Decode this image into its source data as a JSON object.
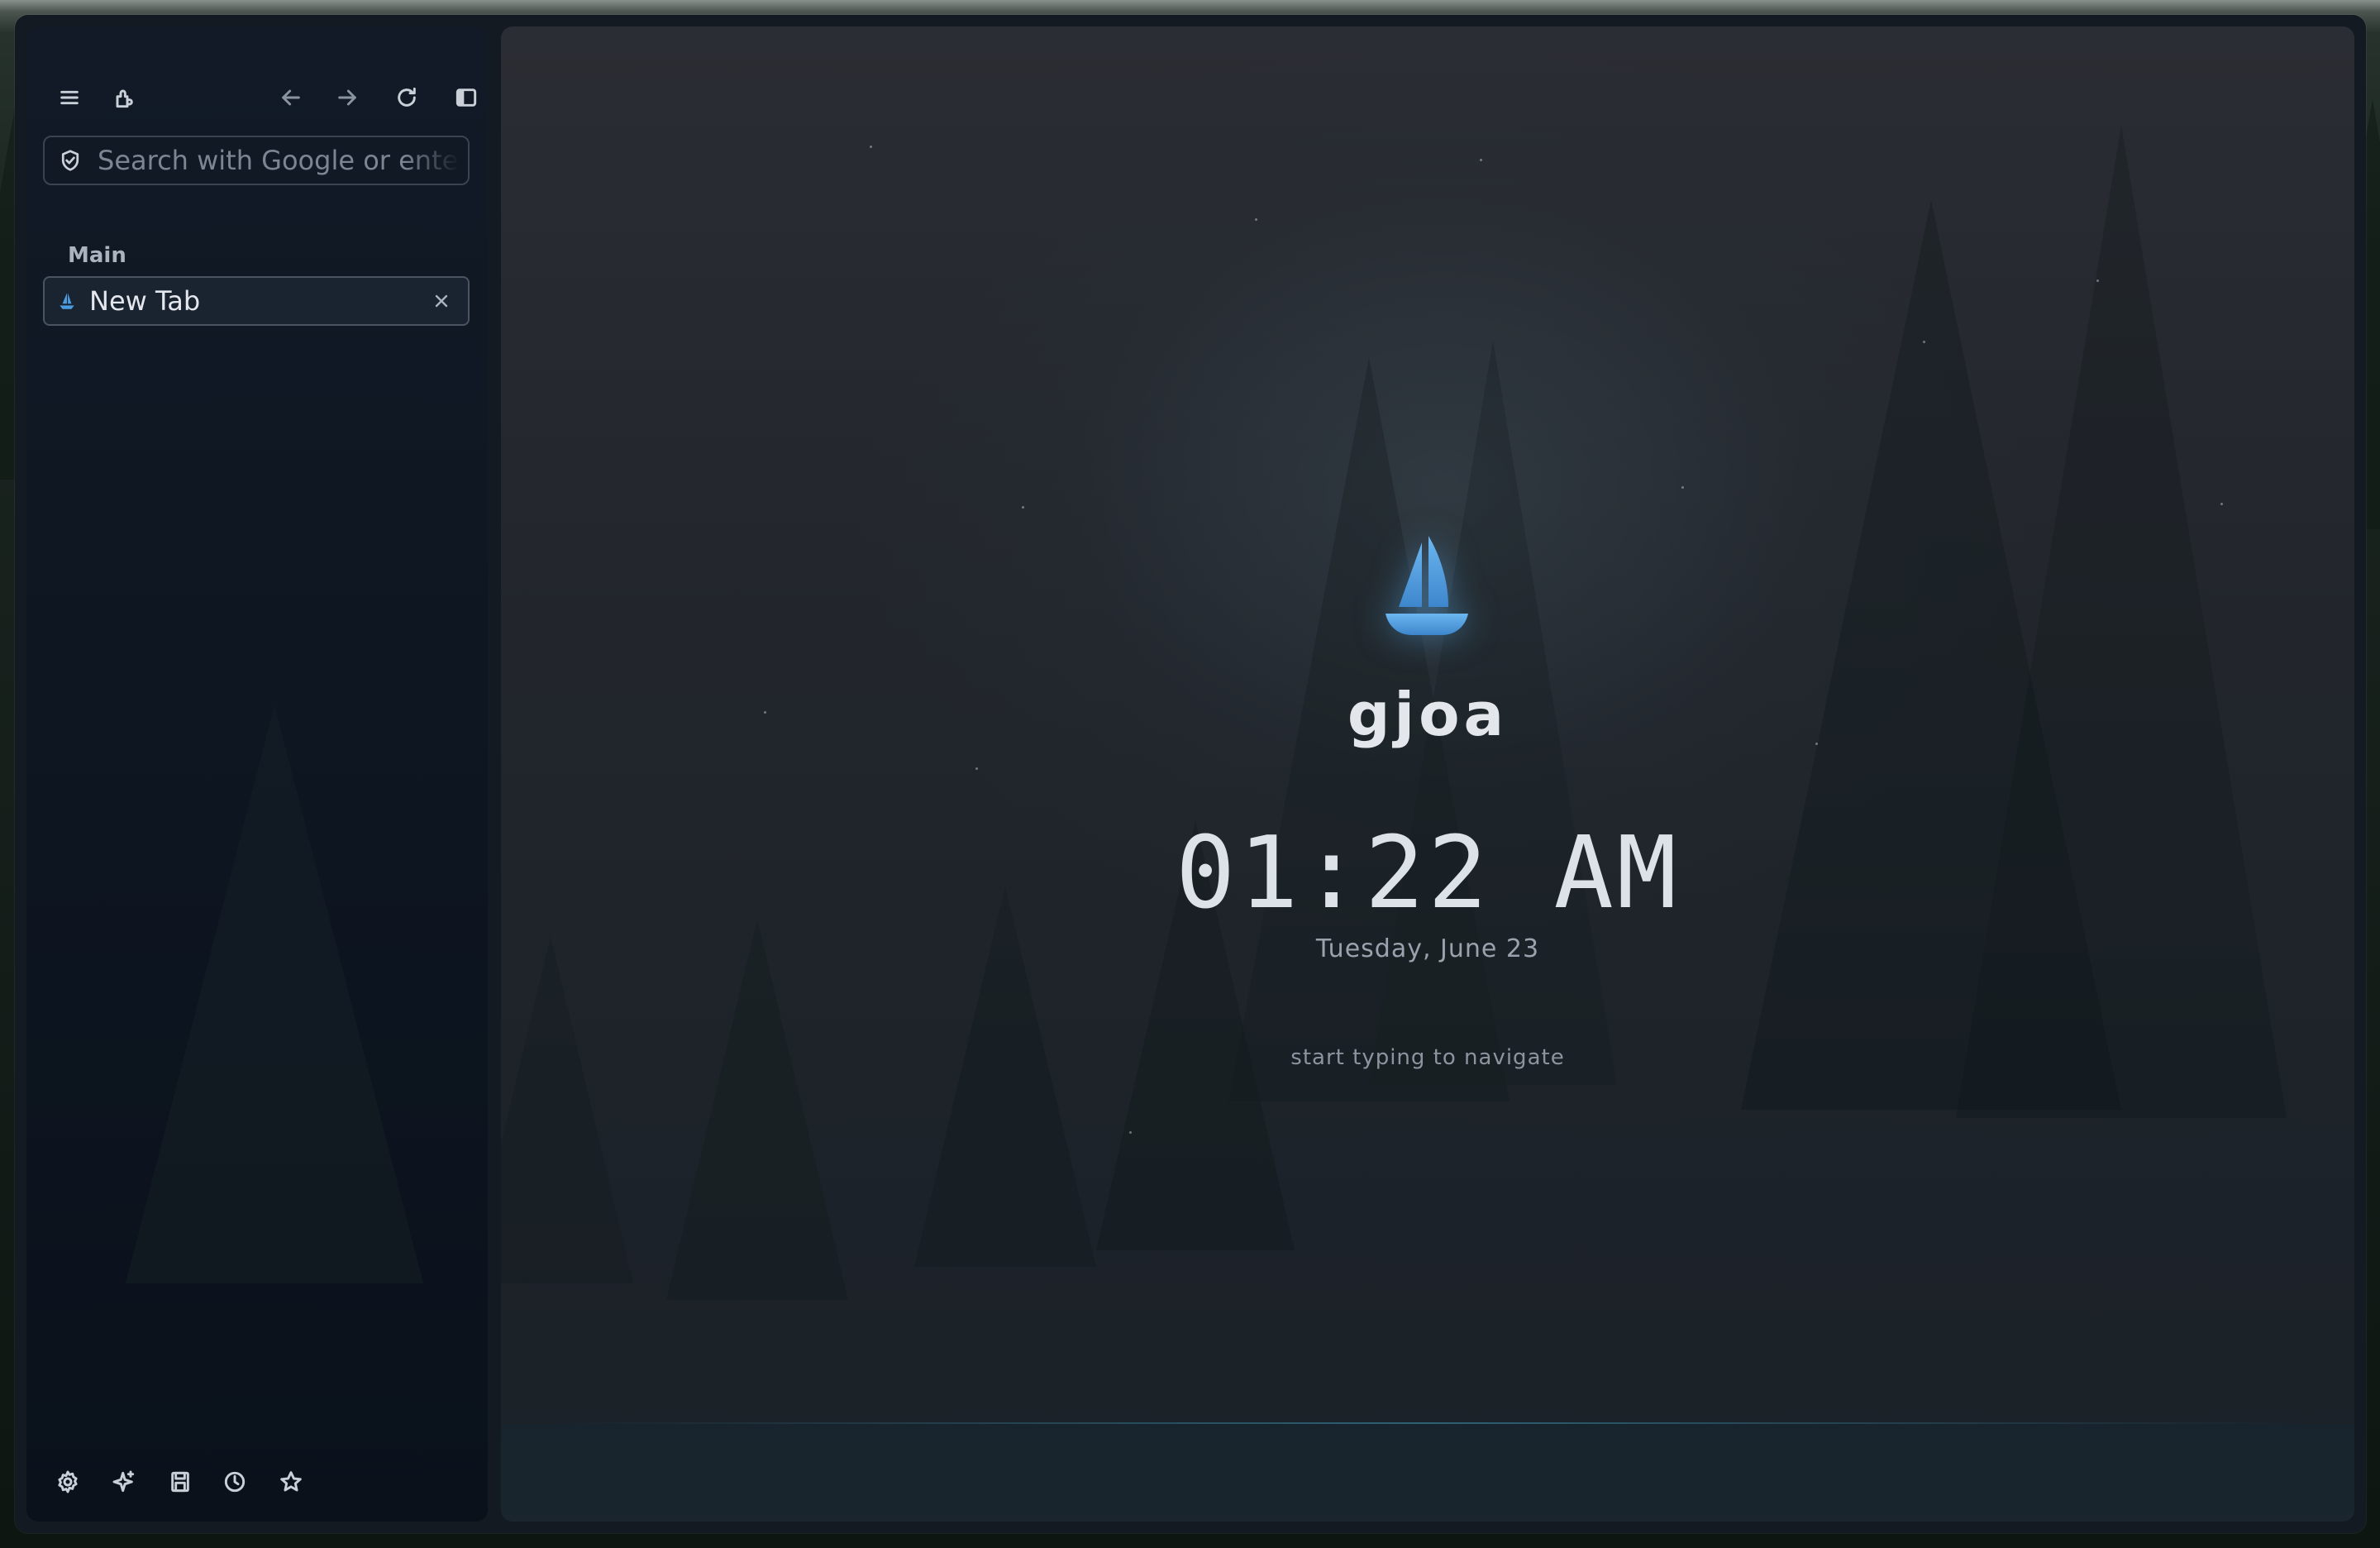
{
  "sidebar": {
    "toolbar": {
      "menu_icon": "menu-icon",
      "extensions_icon": "puzzle-icon",
      "back_icon": "arrow-left-icon",
      "forward_icon": "arrow-right-icon",
      "reload_icon": "reload-icon",
      "sidebar_toggle_icon": "sidebar-toggle-icon"
    },
    "search": {
      "placeholder": "Search with Google or enter address",
      "value": ""
    },
    "section_label": "Main",
    "tabs": [
      {
        "title": "New Tab",
        "favicon": "sailboat-icon",
        "active": true
      }
    ],
    "bottom_tools": [
      "gear-icon",
      "sparkle-icon",
      "save-icon",
      "clock-icon",
      "star-icon"
    ]
  },
  "newtab": {
    "brand": "gjoa",
    "time": "01:22 AM",
    "date": "Tuesday, June 23",
    "hint": "start typing to navigate",
    "logo": "sailboat-icon"
  },
  "colors": {
    "accent": "#4a9be0",
    "sidebar_bg": "#0d1520",
    "content_bg": "#23272d"
  }
}
